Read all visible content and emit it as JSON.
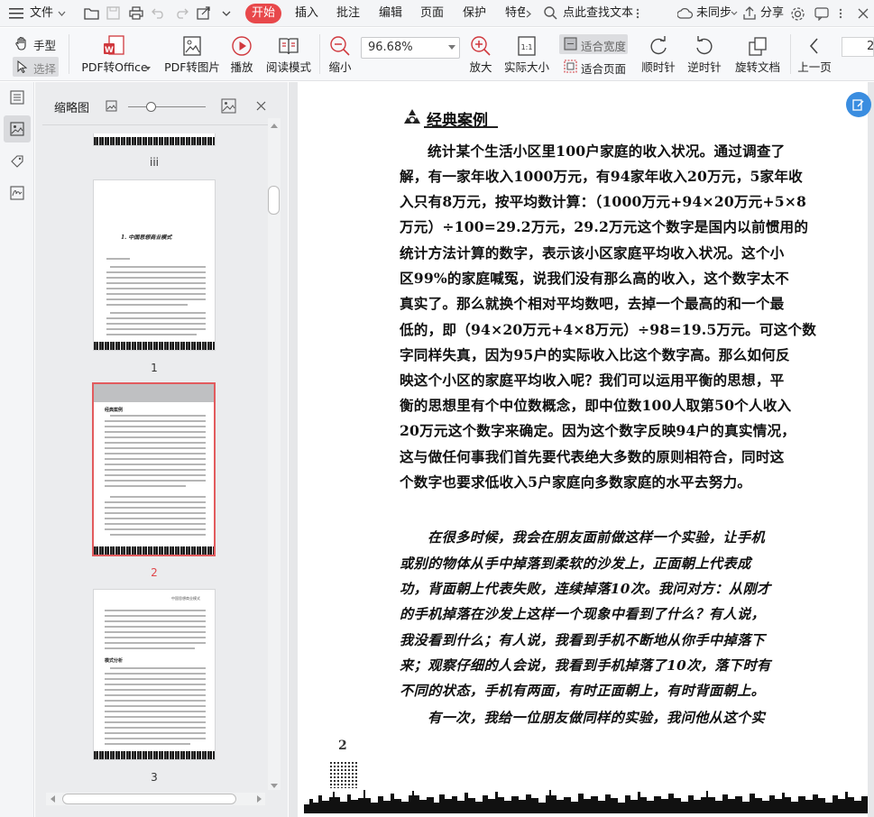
{
  "menu": {
    "file": "文件",
    "tabs": [
      "开始",
      "插入",
      "批注",
      "编辑",
      "页面",
      "保护",
      "特色"
    ],
    "active_tab": "开始",
    "search_placeholder": "点此查找文本",
    "sync": "未同步",
    "share": "分享"
  },
  "toolbar": {
    "hand": "手型",
    "select": "选择",
    "pdf_to_office": "PDF转Office",
    "pdf_to_image": "PDF转图片",
    "play": "播放",
    "read_mode": "阅读模式",
    "zoom_out": "缩小",
    "zoom_value": "96.68%",
    "zoom_in": "放大",
    "actual_size": "实际大小",
    "fit_width": "适合宽度",
    "fit_page": "适合页面",
    "rotate_cw": "顺时针",
    "rotate_ccw": "逆时针",
    "rotate_doc": "旋转文档",
    "prev_page": "上一页",
    "page_input": "2"
  },
  "thumbnail_panel": {
    "title": "缩略图",
    "pages": [
      {
        "label": "iii"
      },
      {
        "label": "1",
        "heading": "1. 中国思想商业模式"
      },
      {
        "label": "2",
        "heading": "经典案例"
      },
      {
        "label": "3",
        "header": "中国思想商业模式",
        "heading": "模式分析"
      }
    ],
    "selected": "2"
  },
  "document": {
    "heading": "经典案例",
    "paragraph1": [
      "统计某个生活小区里100户家庭的收入状况。通过调查了",
      "解，有一家年收入1000万元，有94家年收入20万元，5家年收",
      "入只有8万元，按平均数计算：（1000万元+94×20万元+5×8",
      "万元）÷100=29.2万元，29.2万元这个数字是国内以前惯用的",
      "统计方法计算的数字，表示该小区家庭平均收入状况。这个小",
      "区99%的家庭喊冤，说我们没有那么高的收入，这个数字太不",
      "真实了。那么就换个相对平均数吧，去掉一个最高的和一个最",
      "低的，即（94×20万元+4×8万元）÷98=19.5万元。可这个数",
      "字同样失真，因为95户的实际收入比这个数字高。那么如何反",
      "映这个小区的家庭平均收入呢？我们可以运用平衡的思想，平",
      "衡的思想里有个中位数概念，即中位数100人取第50个人收入",
      "20万元这个数字来确定。因为这个数字反映94户的真实情况，",
      "这与做任何事我们首先要代表绝大多数的原则相符合，同时这",
      "个数字也要求低收入5户家庭向多数家庭的水平去努力。"
    ],
    "paragraph2": [
      "在很多时候，我会在朋友面前做这样一个实验，让手机",
      "或别的物体从手中掉落到柔软的沙发上，正面朝上代表成",
      "功，背面朝上代表失败，连续掉落10次。我问对方：从刚才",
      "的手机掉落在沙发上这样一个现象中看到了什么？有人说，",
      "我没看到什么；有人说，我看到手机不断地从你手中掉落下",
      "来；观察仔细的人会说，我看到手机掉落了10次，落下时有",
      "不同的状态，手机有两面，有时正面朝上，有时背面朝上。",
      "有一次，我给一位朋友做同样的实验，我问他从这个实"
    ],
    "page_number": "2"
  }
}
